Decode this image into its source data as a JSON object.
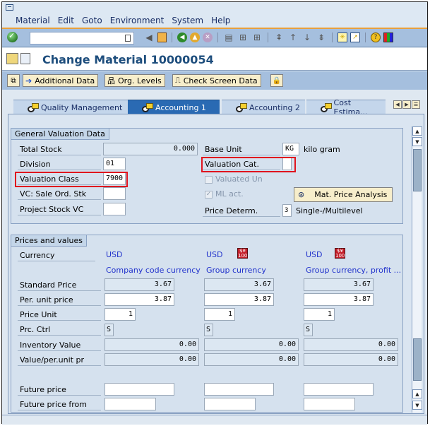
{
  "menubar": {
    "items": [
      "Material",
      "Edit",
      "Goto",
      "Environment",
      "System",
      "Help"
    ]
  },
  "toolbar": {
    "command_field_value": "",
    "icons": [
      "enter-icon",
      "back-nav-icon",
      "save-icon",
      "back-icon",
      "exit-icon",
      "cancel-icon",
      "print-icon",
      "find-icon",
      "find-next-icon",
      "first-page-icon",
      "prev-page-icon",
      "next-page-icon",
      "last-page-icon",
      "new-session-icon",
      "shortcut-icon",
      "help-icon",
      "customize-layout-icon"
    ]
  },
  "title": {
    "text": "Change Material 10000054"
  },
  "appbar": {
    "additional_data": "Additional Data",
    "org_levels": "Org. Levels",
    "check_screen_data": "Check Screen Data"
  },
  "tabs": [
    {
      "label": "Quality Management",
      "active": false
    },
    {
      "label": "Accounting 1",
      "active": true
    },
    {
      "label": "Accounting 2",
      "active": false
    },
    {
      "label": "Cost Estima...",
      "active": false
    }
  ],
  "general": {
    "title": "General Valuation Data",
    "total_stock_label": "Total Stock",
    "total_stock_value": "0.000",
    "division_label": "Division",
    "division_value": "01",
    "valuation_class_label": "Valuation Class",
    "valuation_class_value": "7900",
    "vc_sale_label": "VC: Sale Ord. Stk",
    "vc_sale_value": "",
    "project_stock_label": "Project Stock VC",
    "project_stock_value": "",
    "base_unit_label": "Base Unit",
    "base_unit_value": "KG",
    "base_unit_text": "kilo gram",
    "valuation_cat_label": "Valuation Cat.",
    "valuation_cat_value": "",
    "valuated_un_label": "Valuated Un",
    "valuated_un_checked": false,
    "ml_act_label": "ML act.",
    "ml_act_checked": true,
    "mat_price_analysis": "Mat. Price Analysis",
    "price_determ_label": "Price Determ.",
    "price_determ_value": "3",
    "price_determ_text": "Single-/Multilevel"
  },
  "prices": {
    "title": "Prices and values",
    "currency_label": "Currency",
    "row_labels": {
      "standard_price": "Standard Price",
      "per_unit_price": "Per. unit price",
      "price_unit": "Price Unit",
      "prc_ctrl": "Prc. Ctrl",
      "inventory_value": "Inventory Value",
      "value_per_unit": "Value/per.unit pr",
      "future_price": "Future price",
      "future_price_from": "Future price from"
    },
    "columns": [
      {
        "currency": "USD",
        "desc": "Company code currency",
        "standard_price": "3.67",
        "per_unit_price": "3.87",
        "price_unit": "1",
        "prc_ctrl": "S",
        "inventory_value": "0.00",
        "value_per_unit": "0.00",
        "future_price": "",
        "future_price_from": ""
      },
      {
        "currency": "USD",
        "desc": "Group currency",
        "standard_price": "3.67",
        "per_unit_price": "3.87",
        "price_unit": "1",
        "prc_ctrl": "S",
        "inventory_value": "0.00",
        "value_per_unit": "0.00",
        "future_price": "",
        "future_price_from": ""
      },
      {
        "currency": "USD",
        "desc": "Group currency, profit ...",
        "standard_price": "3.67",
        "per_unit_price": "3.87",
        "price_unit": "1",
        "prc_ctrl": "S",
        "inventory_value": "0.00",
        "value_per_unit": "0.00",
        "future_price": "",
        "future_price_from": ""
      }
    ]
  },
  "colors": {
    "title": "#1e4e7d",
    "active_tab": "#2a6ab3",
    "highlight": "#e0141e",
    "currency_text": "#2233cc"
  }
}
